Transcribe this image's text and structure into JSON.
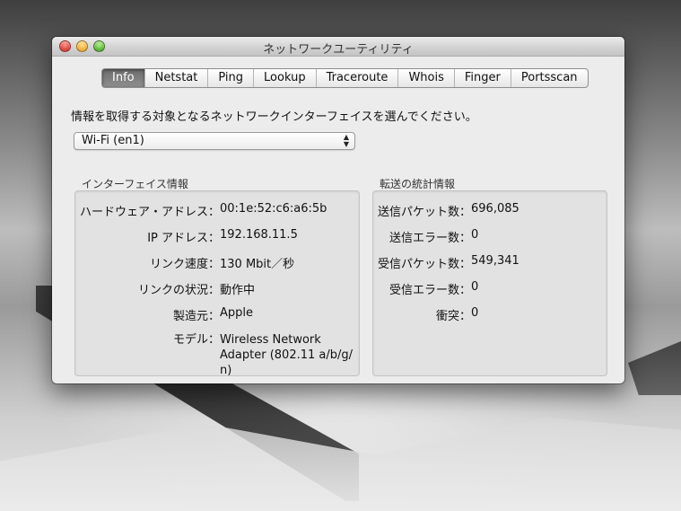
{
  "window": {
    "title": "ネットワークユーティリティ"
  },
  "tabs": [
    {
      "label": "Info",
      "active": true
    },
    {
      "label": "Netstat"
    },
    {
      "label": "Ping"
    },
    {
      "label": "Lookup"
    },
    {
      "label": "Traceroute"
    },
    {
      "label": "Whois"
    },
    {
      "label": "Finger"
    },
    {
      "label": "Portsscan"
    }
  ],
  "prompt": "情報を取得する対象となるネットワークインターフェイスを選んでください。",
  "interface_select": {
    "value": "Wi-Fi (en1)",
    "arrows_up": "▲",
    "arrows_down": "▼"
  },
  "interface_info": {
    "label": "インターフェイス情報",
    "rows": [
      {
        "key": "ハードウェア・アドレス：",
        "value": "00:1e:52:c6:a6:5b"
      },
      {
        "key": "IP アドレス：",
        "value": "192.168.11.5"
      },
      {
        "key": "リンク速度：",
        "value": "130 Mbit／秒"
      },
      {
        "key": "リンクの状況：",
        "value": "動作中"
      },
      {
        "key": "製造元：",
        "value": "Apple"
      },
      {
        "key": "モデル：",
        "value": "Wireless Network\nAdapter (802.11 a/b/g/\nn)"
      }
    ]
  },
  "transfer_stats": {
    "label": "転送の統計情報",
    "rows": [
      {
        "key": "送信パケット数：",
        "value": "696,085"
      },
      {
        "key": "送信エラー数：",
        "value": "0"
      },
      {
        "key": "受信パケット数：",
        "value": "549,341"
      },
      {
        "key": "受信エラー数：",
        "value": "0"
      },
      {
        "key": "衝突：",
        "value": "0"
      }
    ]
  },
  "colors": {
    "active_tab": "#7a7a7a",
    "window_bg": "#ececec",
    "panel_bg": "#e2e2e2"
  }
}
